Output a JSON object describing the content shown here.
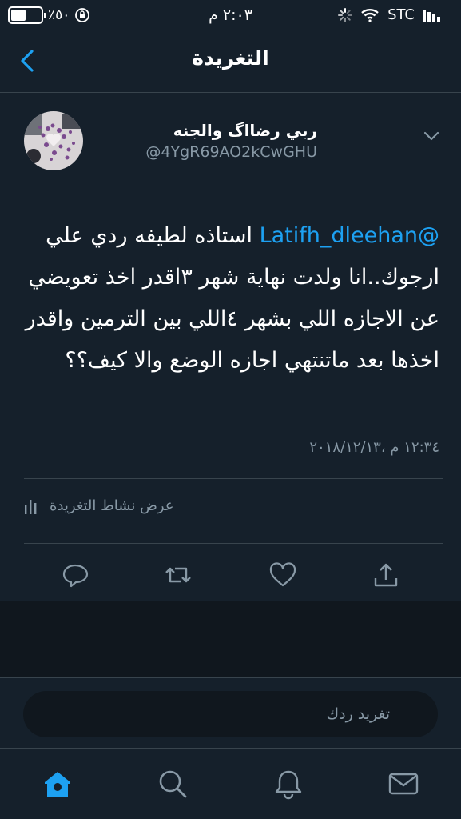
{
  "status_bar": {
    "carrier": "STC",
    "time": "٢:٠٣ م",
    "battery_percent": "٪٥٠",
    "battery_level": 0.5
  },
  "nav": {
    "title": "التغريدة",
    "back_icon": "chevron-left-icon"
  },
  "tweet": {
    "author_name": "ربي رضااگ والجنه",
    "author_handle": "@4YgR69AO2kCwGHU",
    "mention": "@Latifh_dleehan",
    "text": " استاذه لطيفه ردي علي ارجوك..انا ولدت نهاية شهر ٣اقدر اخذ تعويضي عن الاجازه اللي بشهر ٤اللي بين الترمين واقدر اخذها بعد ماتنتهي اجازه الوضع والا كيف؟؟",
    "timestamp": "١٢:٣٤ م ،٢٠١٨/١٢/١٣",
    "activity_label": "عرض نشاط التغريدة",
    "actions": [
      "reply-icon",
      "retweet-icon",
      "like-icon",
      "share-icon"
    ]
  },
  "composer": {
    "placeholder": "تغريد ردك"
  },
  "tabbar": {
    "items": [
      "home-icon",
      "search-icon",
      "notifications-icon",
      "messages-icon"
    ],
    "accent": "#1da1f2"
  },
  "colors": {
    "background": "#15202b",
    "secondary_text": "#8899a6",
    "accent": "#1da1f2",
    "divider": "#38444d"
  }
}
